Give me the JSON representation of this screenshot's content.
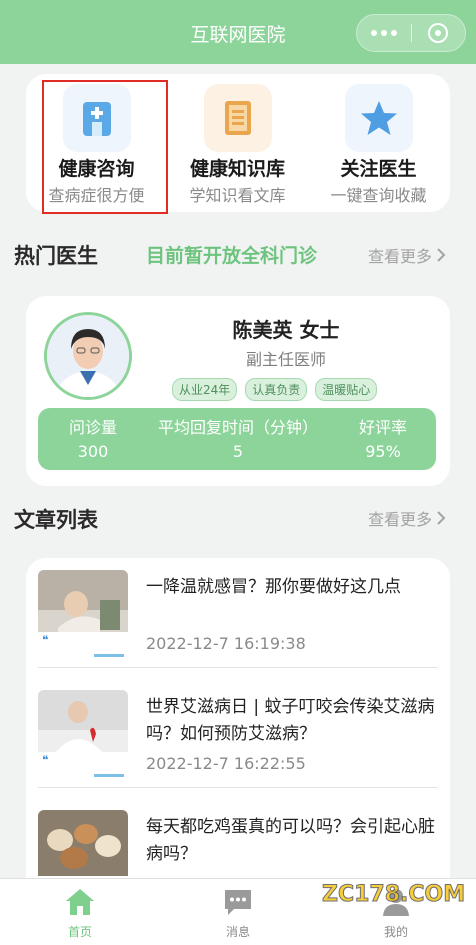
{
  "nav": {
    "title": "互联网医院"
  },
  "quick": [
    {
      "label": "健康咨询",
      "sub": "查病症很方便",
      "icon": "hospital-icon"
    },
    {
      "label": "健康知识库",
      "sub": "学知识看文库",
      "icon": "book-icon"
    },
    {
      "label": "关注医生",
      "sub": "一键查询收藏",
      "icon": "star-icon"
    }
  ],
  "hot": {
    "title": "热门医生",
    "note": "目前暂开放全科门诊",
    "more": "查看更多"
  },
  "doctor": {
    "name": "陈美英 女士",
    "title": "副主任医师",
    "tags": [
      "从业24年",
      "认真负责",
      "温暖贴心"
    ],
    "stats": [
      {
        "label": "问诊量",
        "value": "300"
      },
      {
        "label": "平均回复时间（分钟）",
        "value": "5"
      },
      {
        "label": "好评率",
        "value": "95%"
      }
    ]
  },
  "articles_section": {
    "title": "文章列表",
    "more": "查看更多"
  },
  "articles": [
    {
      "title": "一降温就感冒？那你要做好这几点",
      "date": "2022-12-7 16:19:38"
    },
    {
      "title": "世界艾滋病日 | 蚊子叮咬会传染艾滋病吗？如何预防艾滋病？",
      "date": "2022-12-7 16:22:55"
    },
    {
      "title": "每天都吃鸡蛋真的可以吗？会引起心脏病吗？",
      "date": ""
    }
  ],
  "tabbar": [
    {
      "label": "首页",
      "icon": "home-icon",
      "active": true
    },
    {
      "label": "消息",
      "icon": "message-icon",
      "active": false
    },
    {
      "label": "我的",
      "icon": "user-icon",
      "active": false
    }
  ],
  "watermark": "ZC178.COM",
  "colors": {
    "primary": "#8cd49a",
    "accent_text": "#6ec47f",
    "highlight_border": "#e32b25"
  }
}
